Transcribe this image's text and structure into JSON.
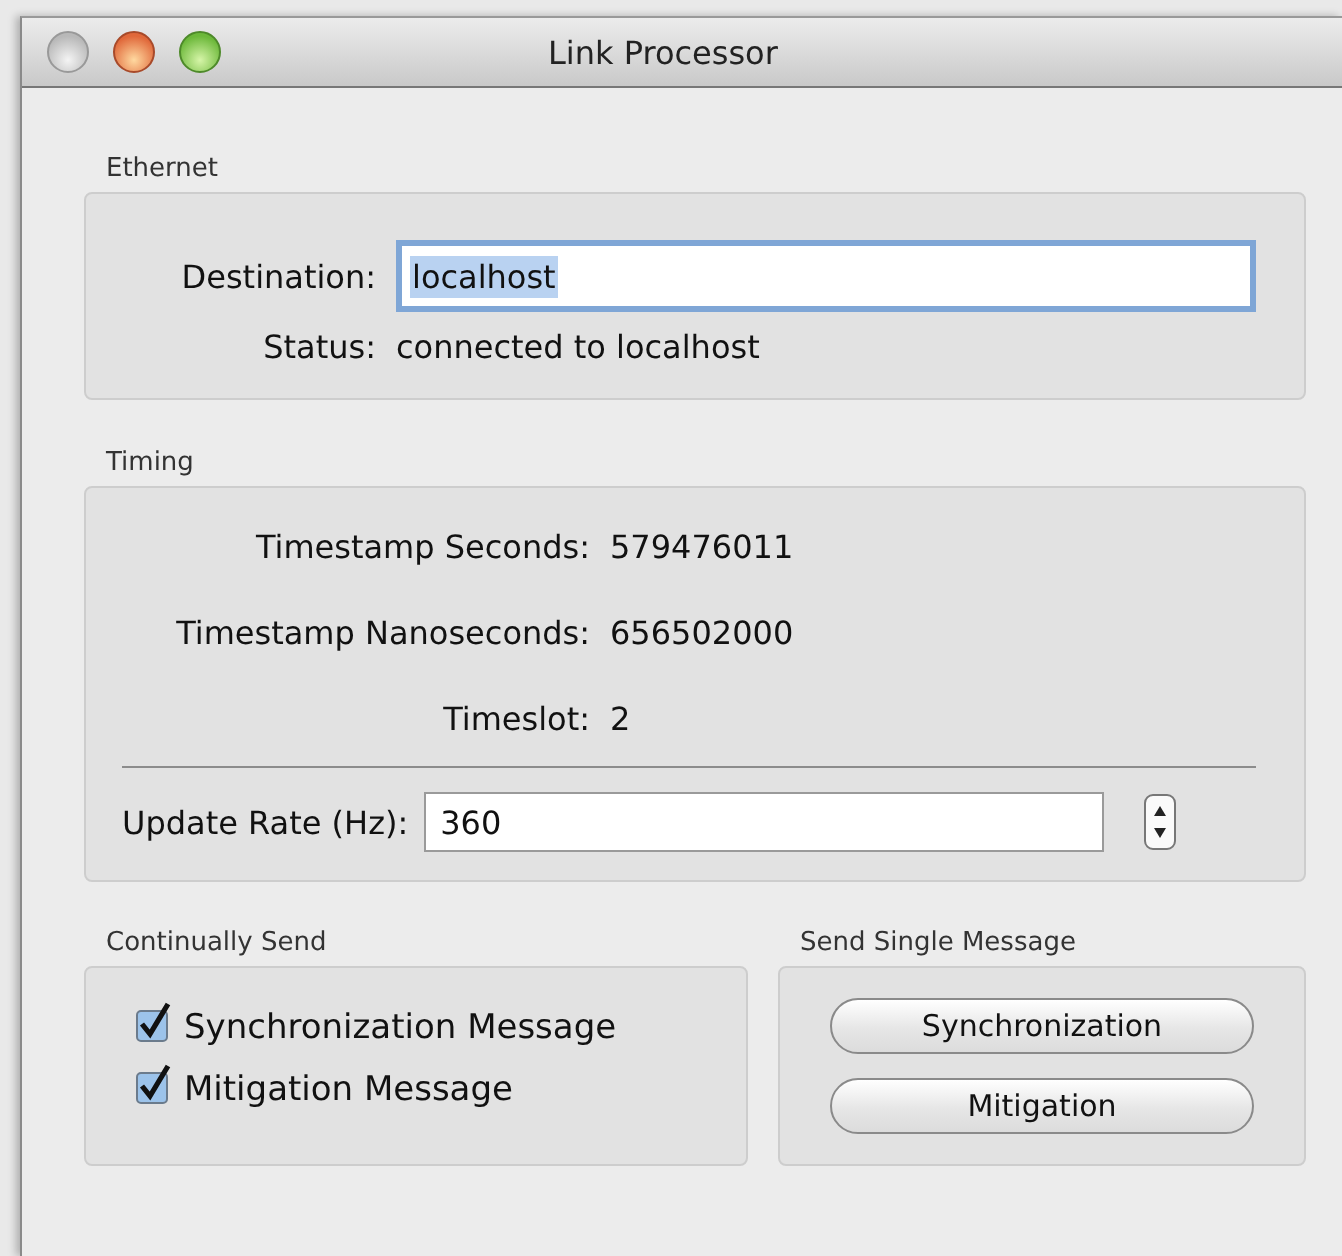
{
  "window": {
    "title": "Link Processor"
  },
  "ethernet": {
    "title": "Ethernet",
    "destination": {
      "label": "Destination:",
      "value": "localhost",
      "text_selected": true,
      "focused": true
    },
    "status": {
      "label": "Status:",
      "value": "connected to localhost"
    }
  },
  "timing": {
    "title": "Timing",
    "readings": [
      {
        "label": "Timestamp Seconds:",
        "value": "579476011"
      },
      {
        "label": "Timestamp Nanoseconds:",
        "value": "656502000"
      },
      {
        "label": "Timeslot:",
        "value": "2"
      }
    ],
    "update_rate": {
      "label": "Update Rate (Hz):",
      "value": "360"
    }
  },
  "continually_send": {
    "title": "Continually Send",
    "options": [
      {
        "label": "Synchronization Message",
        "checked": true
      },
      {
        "label": "Mitigation Message",
        "checked": true
      }
    ]
  },
  "send_single": {
    "title": "Send Single Message",
    "buttons": [
      "Synchronization",
      "Mitigation"
    ]
  }
}
